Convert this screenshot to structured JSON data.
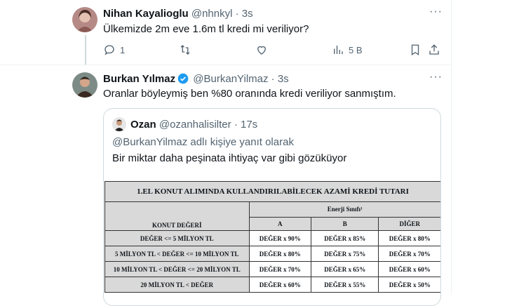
{
  "tweet1": {
    "name": "Nihan Kayalioglu",
    "handle": "@nhnkyl",
    "time": "· 3s",
    "text": "Ülkemizde 2m eve 1.6m tl kredi mi veriliyor?",
    "actions": {
      "replies": "1",
      "retweets": "",
      "likes": "",
      "views": "5 B"
    }
  },
  "tweet2": {
    "name": "Burkan Yılmaz",
    "handle": "@BurkanYilmaz",
    "time": "· 3s",
    "text": "Oranlar böyleymiş ben %80 oranında kredi veriliyor sanmıştım."
  },
  "quote": {
    "name": "Ozan",
    "handle": "@ozanhalisilter",
    "time": "· 17s",
    "reply_to": "@BurkanYilmaz adlı kişiye yanıt olarak",
    "text": "Bir miktar daha peşinata ihtiyaç var gibi gözüküyor"
  },
  "table": {
    "title": "1.EL KONUT ALIMINDA KULLANDIRILABİLECEK AZAMİ KREDİ TUTARI",
    "row_header": "KONUT DEĞERİ",
    "group_header": "Enerji Sınıfı¹",
    "columns": [
      "A",
      "B",
      "DİĞER"
    ],
    "rows": [
      {
        "label": "DEĞER <= 5 MİLYON TL",
        "a": "DEĞER x 90%",
        "b": "DEĞER x 85%",
        "c": "DEĞER x 80%"
      },
      {
        "label": "5 MİLYON TL < DEĞER <= 10 MİLYON TL",
        "a": "DEĞER x 80%",
        "b": "DEĞER x 75%",
        "c": "DEĞER x 70%"
      },
      {
        "label": "10 MİLYON TL < DEĞER <= 20 MİLYON TL",
        "a": "DEĞER x 70%",
        "b": "DEĞER x 65%",
        "c": "DEĞER x 60%"
      },
      {
        "label": "20 MİLYON TL < DEĞER",
        "a": "DEĞER x 60%",
        "b": "DEĞER x 55%",
        "c": "DEĞER x 50%"
      }
    ]
  },
  "colors": {
    "verified": "#1d9bf0",
    "muted": "#536471",
    "border": "#cfd9de"
  }
}
